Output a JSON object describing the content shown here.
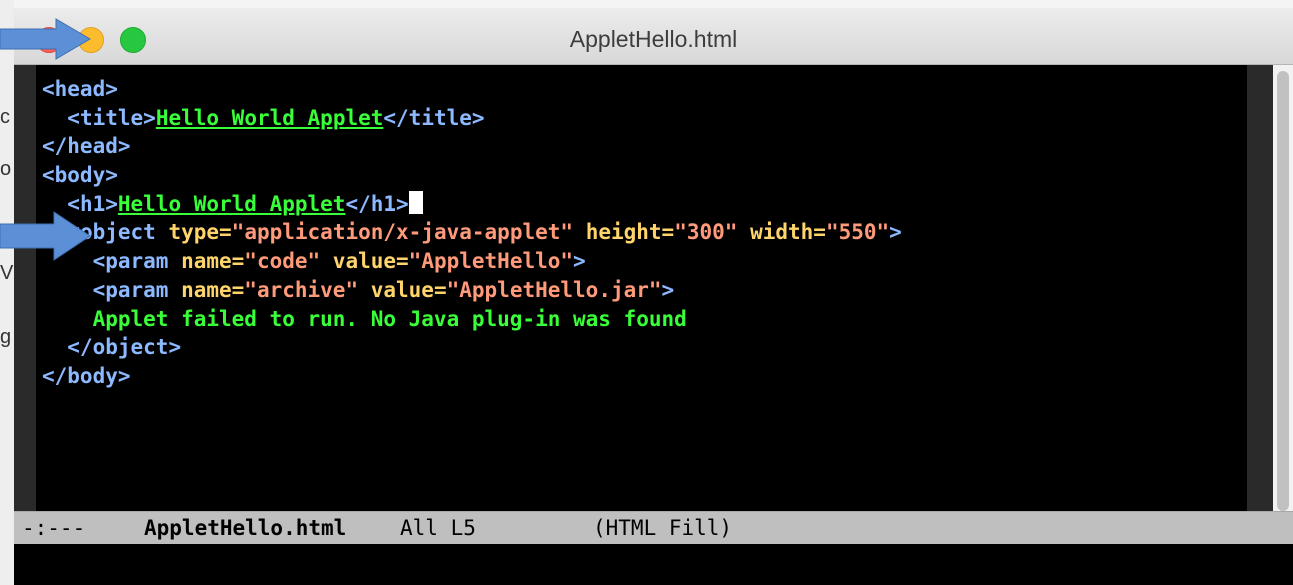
{
  "window": {
    "title": "AppletHello.html"
  },
  "background": {
    "left_fragments": [
      "c",
      "o",
      "V",
      "g"
    ]
  },
  "code_lines": [
    [
      {
        "t": "<head>",
        "c": "tag",
        "i": 0
      }
    ],
    [
      {
        "t": "  ",
        "c": "txt"
      },
      {
        "t": "<title>",
        "c": "tag"
      },
      {
        "t": "Hello World Applet",
        "c": "link"
      },
      {
        "t": "</title>",
        "c": "tag"
      }
    ],
    [
      {
        "t": "</head>",
        "c": "tag"
      }
    ],
    [
      {
        "t": "<body>",
        "c": "tag"
      }
    ],
    [
      {
        "t": "  ",
        "c": "txt"
      },
      {
        "t": "<h1>",
        "c": "tag"
      },
      {
        "t": "Hello World Applet",
        "c": "link"
      },
      {
        "t": "</h1>",
        "c": "tag"
      },
      {
        "t": "",
        "c": "cursor"
      }
    ],
    [
      {
        "t": "  ",
        "c": "txt"
      },
      {
        "t": "<object",
        "c": "tag"
      },
      {
        "t": " type=",
        "c": "attr"
      },
      {
        "t": "\"application/x-java-applet\"",
        "c": "str"
      },
      {
        "t": " height=",
        "c": "attr"
      },
      {
        "t": "\"300\"",
        "c": "str"
      },
      {
        "t": " width=",
        "c": "attr"
      },
      {
        "t": "\"550\"",
        "c": "str"
      },
      {
        "t": ">",
        "c": "tag"
      }
    ],
    [
      {
        "t": "    ",
        "c": "txt"
      },
      {
        "t": "<param",
        "c": "tag"
      },
      {
        "t": " name=",
        "c": "attr"
      },
      {
        "t": "\"code\"",
        "c": "str"
      },
      {
        "t": " value=",
        "c": "attr"
      },
      {
        "t": "\"AppletHello\"",
        "c": "str"
      },
      {
        "t": ">",
        "c": "tag"
      }
    ],
    [
      {
        "t": "    ",
        "c": "txt"
      },
      {
        "t": "<param",
        "c": "tag"
      },
      {
        "t": " name=",
        "c": "attr"
      },
      {
        "t": "\"archive\"",
        "c": "str"
      },
      {
        "t": " value=",
        "c": "attr"
      },
      {
        "t": "\"AppletHello.jar\"",
        "c": "str"
      },
      {
        "t": ">",
        "c": "tag"
      }
    ],
    [
      {
        "t": "    Applet failed to run. No Java plug-in was found",
        "c": "txt"
      }
    ],
    [
      {
        "t": "  ",
        "c": "txt"
      },
      {
        "t": "</object>",
        "c": "tag"
      }
    ],
    [
      {
        "t": "</body>",
        "c": "tag"
      }
    ]
  ],
  "modeline": {
    "status": "-:---",
    "buffer": "AppletHello.html",
    "position": "All L5",
    "mode": "(HTML Fill)"
  },
  "colors": {
    "tag": "#8cb9ff",
    "attribute": "#ffd56b",
    "string": "#ff9a7a",
    "text": "#39ff39",
    "annotation_arrow": "#5b8fd6"
  },
  "annotations": [
    "arrow-pointing-minimize-button",
    "arrow-pointing-object-line"
  ]
}
